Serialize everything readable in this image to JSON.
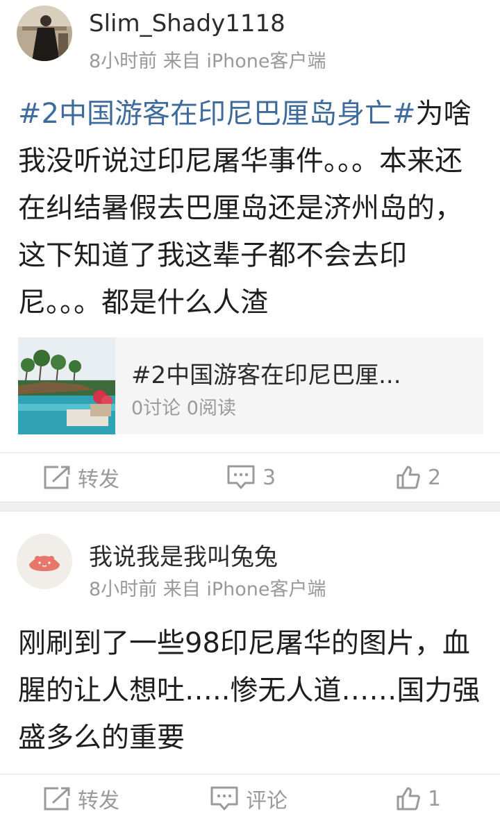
{
  "posts": [
    {
      "username": "Slim_Shady1118",
      "time": "8小时前",
      "source": "来自 iPhone客户端",
      "topic": "#2中国游客在印尼巴厘岛身亡#",
      "text": "为啥我没听说过印尼屠华事件。。。本来还在纠结暑假去巴厘岛还是济州岛的，这下知道了我这辈子都不会去印尼。。。都是什么人渣",
      "card": {
        "title": "#2中国游客在印尼巴厘...",
        "stats": "0讨论 0阅读"
      },
      "actions": {
        "repost": "转发",
        "comments": "3",
        "likes": "2"
      }
    },
    {
      "username": "我说我是我叫兔兔",
      "time": "8小时前",
      "source": "来自 iPhone客户端",
      "text": "刚刷到了一些98印尼屠华的图片，血腥的让人想吐…..惨无人道……国力强盛多么的重要",
      "actions": {
        "repost": "转发",
        "comments": "评论",
        "likes": "1"
      }
    }
  ],
  "colors": {
    "topic": "#3e6a9c",
    "meta": "#999999",
    "separator": "#f0f0f0"
  },
  "icons": {
    "repost": "share-box-icon",
    "comment": "speech-bubble-icon",
    "like": "thumbs-up-icon"
  }
}
